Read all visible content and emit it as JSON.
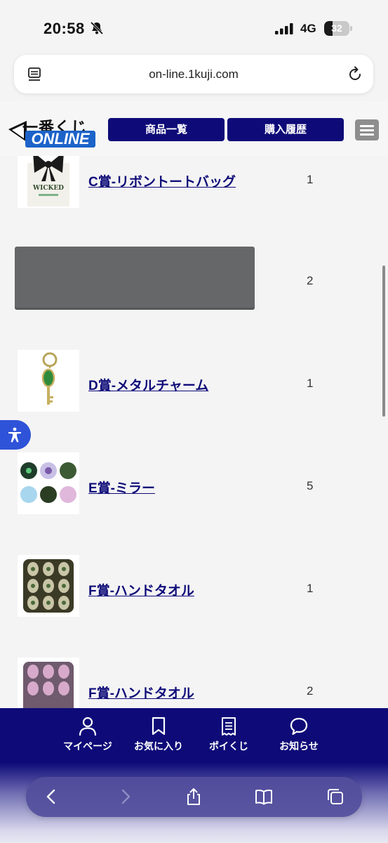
{
  "status_bar": {
    "time": "20:58",
    "network": "4G",
    "battery_level": "32",
    "icons": [
      "bell-slash-icon",
      "signal-bars-icon",
      "battery-icon"
    ]
  },
  "browser": {
    "url": "on-line.1kuji.com",
    "icons": [
      "reader-mode-icon",
      "reload-icon"
    ]
  },
  "site_header": {
    "logo_top": "一番くじ",
    "logo_bottom": "ONLINE",
    "nav_products": "商品一覧",
    "nav_history": "購入履歴",
    "menu_icon": "hamburger-icon"
  },
  "prizes": [
    {
      "name": "C賞-リボントートバッグ",
      "qty": "1"
    },
    {
      "name": "",
      "qty": "2"
    },
    {
      "name": "D賞-メタルチャーム",
      "qty": "1"
    },
    {
      "name": "E賞-ミラー",
      "qty": "5"
    },
    {
      "name": "F賞-ハンドタオル",
      "qty": "1"
    },
    {
      "name": "F賞-ハンドタオル",
      "qty": "2"
    }
  ],
  "bottom_nav": {
    "mypage": "マイページ",
    "favorites": "お気に入り",
    "poikuji": "ポイくじ",
    "notices": "お知らせ"
  },
  "toolbar_icons": [
    "back-icon",
    "forward-icon",
    "share-icon",
    "bookmarks-icon",
    "tabs-icon"
  ],
  "colors": {
    "brand_navy": "#0e0b78",
    "accessibility_blue": "#2e53d9",
    "logo_blue": "#1c63c9"
  }
}
